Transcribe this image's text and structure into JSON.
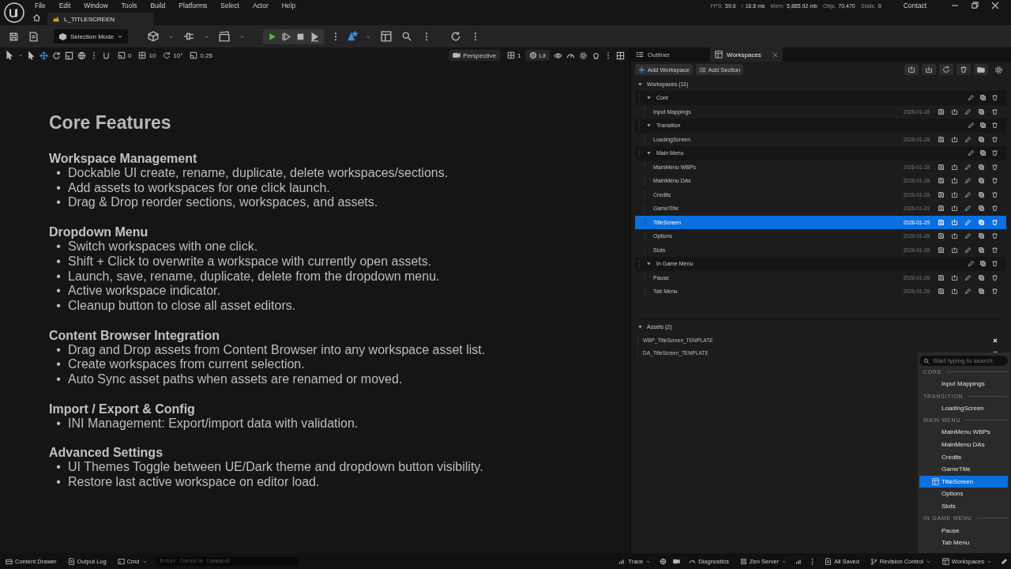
{
  "menu": [
    "File",
    "Edit",
    "Window",
    "Tools",
    "Build",
    "Platforms",
    "Select",
    "Actor",
    "Help"
  ],
  "document_tab": "L_TITLESCREEN",
  "stats": [
    {
      "label": "FPS:",
      "value": "59.6"
    },
    {
      "label": "/",
      "value": "16.8 ms"
    },
    {
      "label": "Mem:",
      "value": "5,885.92 mb"
    },
    {
      "label": "Objs:",
      "value": "70,470"
    },
    {
      "label": "Stalls:",
      "value": "0"
    }
  ],
  "contact": "Contact",
  "toolbar": {
    "mode": "Selection Mode"
  },
  "viewport_toolbar": {
    "snaps": [
      "0",
      "10",
      "10°",
      "0.25"
    ],
    "view": "Perspective",
    "layout": "1",
    "view_mode": "Lit"
  },
  "viewport": {
    "title": "Core Features",
    "sections": [
      {
        "heading": "Workspace Management",
        "marker": "•",
        "bullets": [
          "Dockable UI create, rename, duplicate, delete workspaces/sections.",
          "Add assets to workspaces for one click launch.",
          "Drag & Drop reorder sections, workspaces, and assets."
        ]
      },
      {
        "heading": "Dropdown Menu",
        "marker": "•",
        "bullets": [
          "Switch workspaces with one click.",
          "Shift + Click to overwrite a workspace with currently open assets.",
          "Launch, save, rename, duplicate, delete from the dropdown menu.",
          "Active workspace indicator.",
          "Cleanup button to close all asset editors."
        ]
      },
      {
        "heading": "Content Browser Integration",
        "marker": "•",
        "bullets": [
          "Drag and Drop assets from Content Browser into any workspace asset list.",
          "Create workspaces from current selection.",
          "Auto Sync asset paths when assets are renamed or moved."
        ]
      },
      {
        "heading": "Import / Export & Config",
        "marker": "•",
        "bullets": [
          "INI Management: Export/import data with validation."
        ]
      },
      {
        "heading": "Advanced Settings",
        "marker": "•",
        "bullets": [
          "UI Themes Toggle between UE/Dark theme and dropdown button visibility.",
          "Restore last active workspace on editor load."
        ]
      }
    ]
  },
  "panel": {
    "tabs": [
      {
        "label": "Outliner",
        "selected": false
      },
      {
        "label": "Workspaces",
        "selected": true
      }
    ],
    "buttons": [
      "Add Workspace",
      "Add Section"
    ],
    "workspaces_header": {
      "label": "Workspaces (11)",
      "expanded": true
    },
    "sections": [
      {
        "name": "Core",
        "expanded": true,
        "items": [
          {
            "name": "Input Mappings",
            "date": "2026-01-28",
            "selected": false
          }
        ]
      },
      {
        "name": "Transition",
        "expanded": true,
        "items": [
          {
            "name": "LoadingScreen",
            "date": "2026-01-28",
            "selected": false
          }
        ]
      },
      {
        "name": "Main Menu",
        "expanded": true,
        "items": [
          {
            "name": "MainMenu WBPs",
            "date": "2026-01-28",
            "selected": false
          },
          {
            "name": "MainMenu DAs",
            "date": "2026-01-28",
            "selected": false
          },
          {
            "name": "Credits",
            "date": "2026-01-28",
            "selected": false
          },
          {
            "name": "GameTitle",
            "date": "2026-01-29",
            "selected": false
          },
          {
            "name": "TitleScreen",
            "date": "2026-01-29",
            "selected": true
          },
          {
            "name": "Options",
            "date": "2026-01-28",
            "selected": false
          },
          {
            "name": "Slots",
            "date": "2026-01-28",
            "selected": false
          }
        ]
      },
      {
        "name": "In Game Menu",
        "expanded": true,
        "items": [
          {
            "name": "Pause",
            "date": "2026-01-28",
            "selected": false
          },
          {
            "name": "Tab Menu",
            "date": "2026-01-28",
            "selected": false
          }
        ]
      }
    ],
    "assets_header": {
      "label": "Assets (2)",
      "expanded": true
    },
    "assets": [
      "WBP_TitleScreen_TEMPLATE",
      "DA_TitleScreen_TEMPLATE"
    ]
  },
  "dropdown": {
    "placeholder": "Start typing to search",
    "groups": [
      {
        "label": "CORE",
        "items": [
          {
            "label": "Input Mappings",
            "selected": false
          }
        ]
      },
      {
        "label": "TRANSITION",
        "items": [
          {
            "label": "LoadingScreen",
            "selected": false
          }
        ]
      },
      {
        "label": "MAIN MENU",
        "items": [
          {
            "label": "MainMenu WBPs",
            "selected": false
          },
          {
            "label": "MainMenu DAs",
            "selected": false
          },
          {
            "label": "Credits",
            "selected": false
          },
          {
            "label": "GameTitle",
            "selected": false
          },
          {
            "label": "TitleScreen",
            "selected": true
          },
          {
            "label": "Options",
            "selected": false
          },
          {
            "label": "Slots",
            "selected": false
          }
        ]
      },
      {
        "label": "IN GAME MENU",
        "items": [
          {
            "label": "Pause",
            "selected": false
          },
          {
            "label": "Tab Menu",
            "selected": false
          }
        ]
      }
    ]
  },
  "status_bar": {
    "content_drawer": "Content Drawer",
    "output_log": "Output Log",
    "cmd": "Cmd",
    "console_placeholder": "Enter Console Command",
    "trace": "Trace",
    "diagnostics": "Diagnostics",
    "zen_server": "Zen Server",
    "all_saved": "All Saved",
    "revision_control": "Revision Control",
    "workspaces": "Workspaces"
  }
}
